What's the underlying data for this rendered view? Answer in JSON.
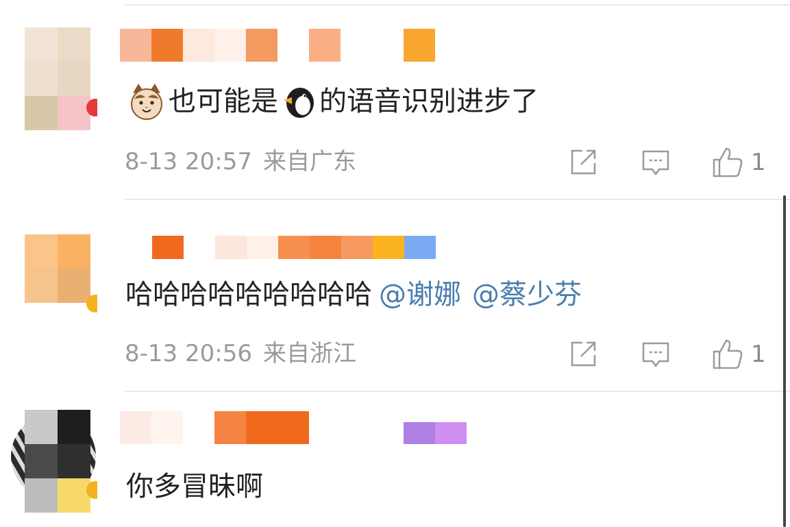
{
  "comments": [
    {
      "text": "也可能是",
      "text_after_emoji": "的语音识别进步了",
      "date": "8-13 20:57",
      "location": "来自广东",
      "like_count": "1",
      "leading_emoji": "cat-face-icon",
      "inline_emoji": "penguin-icon"
    },
    {
      "text": "哈哈哈哈哈哈哈哈哈",
      "mentions": [
        "@谢娜",
        "@蔡少芬"
      ],
      "date": "8-13 20:56",
      "location": "来自浙江",
      "like_count": "1"
    },
    {
      "text": "你多冒昧啊"
    }
  ],
  "icons": {
    "share": "share-icon",
    "reply": "comment-icon",
    "like": "thumbs-up-icon"
  },
  "colors": {
    "text": "#222222",
    "meta": "#9a9a9a",
    "mention": "#4a7dae",
    "divider": "#e9e9e9",
    "badge_red": "#e4393c",
    "badge_orange": "#f5a623"
  }
}
